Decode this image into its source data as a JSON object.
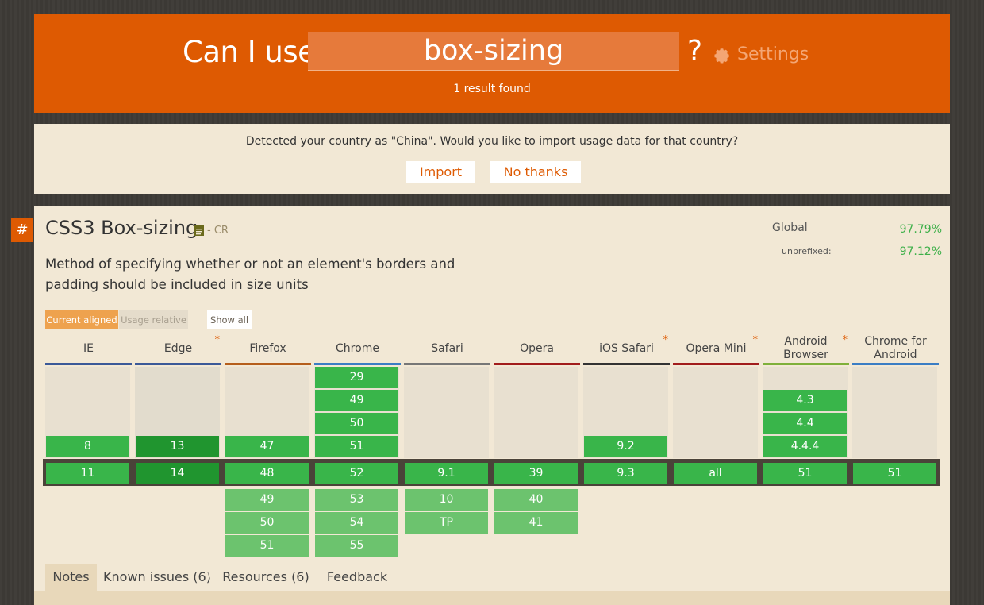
{
  "header": {
    "prefix": "Can I use",
    "search_value": "box-sizing",
    "suffix": "?",
    "settings_label": "Settings",
    "result_text": "1 result found"
  },
  "geo": {
    "message": "Detected your country as \"China\". Would you like to import usage data for that country?",
    "import_label": "Import",
    "no_thanks_label": "No thanks"
  },
  "feature": {
    "hash": "#",
    "title": "CSS3 Box-sizing",
    "status": "- CR",
    "description": "Method of specifying whether or not an element's borders and padding should be included in size units",
    "global_label": "Global",
    "global_value": "97.79%",
    "unprefixed_label": "unprefixed:",
    "unprefixed_value": "97.12%"
  },
  "toggles": {
    "current_aligned": "Current aligned",
    "usage_relative": "Usage relative",
    "show_all": "Show all"
  },
  "browsers": [
    {
      "name": "IE",
      "star": ""
    },
    {
      "name": "Edge",
      "star": "*"
    },
    {
      "name": "Firefox",
      "star": ""
    },
    {
      "name": "Chrome",
      "star": ""
    },
    {
      "name": "Safari",
      "star": ""
    },
    {
      "name": "Opera",
      "star": ""
    },
    {
      "name": "iOS Safari",
      "star": "*"
    },
    {
      "name": "Opera Mini",
      "star": "*"
    },
    {
      "name": "Android Browser",
      "star": "*"
    },
    {
      "name": "Chrome for Android",
      "star": ""
    }
  ],
  "bar_colors": [
    "#3b5998",
    "#3b5998",
    "#b55e1c",
    "#3b7dc4",
    "#777777",
    "#a11c1c",
    "#333333",
    "#a11c1c",
    "#7fb03a",
    "#3b7dc4"
  ],
  "cells": {
    "ie": {
      "past": [
        "8"
      ],
      "current": "11",
      "future": []
    },
    "edge": {
      "past": [
        "13"
      ],
      "current": "14",
      "future": []
    },
    "firefox": {
      "past": [
        "47"
      ],
      "current": "48",
      "future": [
        "49",
        "50",
        "51"
      ]
    },
    "chrome": {
      "past": [
        "29",
        "49",
        "50",
        "51"
      ],
      "current": "52",
      "future": [
        "53",
        "54",
        "55"
      ]
    },
    "safari": {
      "past": [],
      "current": "9.1",
      "future": [
        "10",
        "TP"
      ]
    },
    "opera": {
      "past": [],
      "current": "39",
      "future": [
        "40",
        "41"
      ]
    },
    "ios_safari": {
      "past": [
        "9.2"
      ],
      "current": "9.3",
      "future": []
    },
    "opera_mini": {
      "past": [],
      "current": "all",
      "future": []
    },
    "android": {
      "past": [
        "4.3",
        "4.4",
        "4.4.4"
      ],
      "current": "51",
      "future": []
    },
    "chrome_android": {
      "past": [],
      "current": "51",
      "future": []
    }
  },
  "tabs": [
    "Notes",
    "Known issues (6)",
    "Resources (6)",
    "Feedback"
  ],
  "colors": {
    "brand": "#de5a02",
    "supported": "#39b54a",
    "supported_dark": "#20952f",
    "future": "#6cc36e",
    "panel_bg": "#f2e8d5"
  }
}
